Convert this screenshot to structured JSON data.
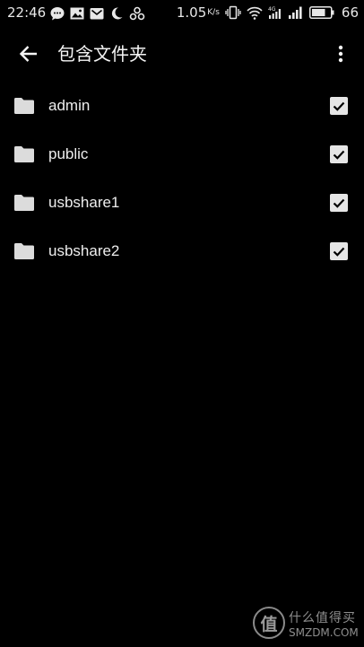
{
  "status_bar": {
    "time": "22:46",
    "notification_icons": [
      "chat-bubble-icon",
      "image-icon",
      "mail-icon",
      "moon-icon",
      "nodes-icon"
    ],
    "net_speed": "1.05",
    "net_speed_unit": "K/s",
    "right_icons": [
      "vibrate-icon",
      "wifi-icon",
      "signal-4g-icon",
      "signal-bars-icon",
      "battery-icon"
    ],
    "battery": "66"
  },
  "app_bar": {
    "title": "包含文件夹",
    "back_icon": "arrow-left-icon",
    "menu_icon": "more-vert-icon"
  },
  "folders": [
    {
      "name": "admin",
      "checked": true
    },
    {
      "name": "public",
      "checked": true
    },
    {
      "name": "usbshare1",
      "checked": true
    },
    {
      "name": "usbshare2",
      "checked": true
    }
  ],
  "colors": {
    "background": "#000000",
    "text": "#eeeeee",
    "checkbox": "#e6e6e6",
    "folder_icon": "#dcdcdc"
  },
  "watermark": {
    "badge": "值",
    "cn": "什么值得买",
    "en": "SMZDM.COM"
  }
}
